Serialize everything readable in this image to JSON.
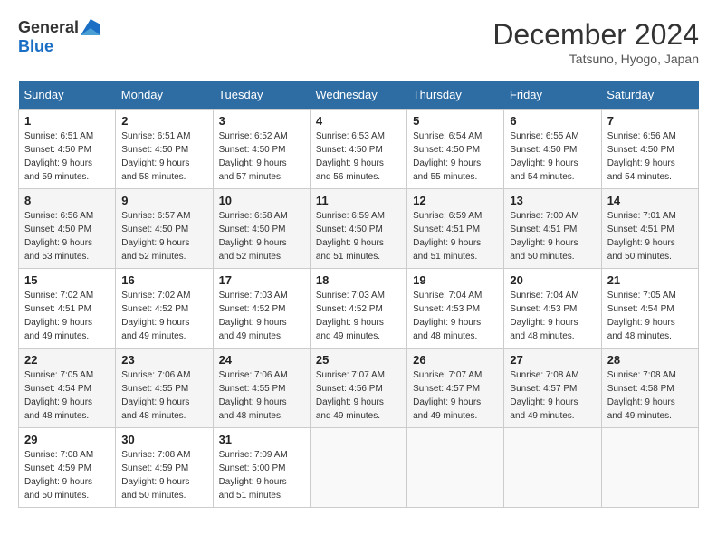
{
  "header": {
    "logo_general": "General",
    "logo_blue": "Blue",
    "title": "December 2024",
    "location": "Tatsuno, Hyogo, Japan"
  },
  "calendar": {
    "days_of_week": [
      "Sunday",
      "Monday",
      "Tuesday",
      "Wednesday",
      "Thursday",
      "Friday",
      "Saturday"
    ],
    "weeks": [
      [
        {
          "day": "1",
          "sunrise": "6:51 AM",
          "sunset": "4:50 PM",
          "daylight": "9 hours and 59 minutes."
        },
        {
          "day": "2",
          "sunrise": "6:51 AM",
          "sunset": "4:50 PM",
          "daylight": "9 hours and 58 minutes."
        },
        {
          "day": "3",
          "sunrise": "6:52 AM",
          "sunset": "4:50 PM",
          "daylight": "9 hours and 57 minutes."
        },
        {
          "day": "4",
          "sunrise": "6:53 AM",
          "sunset": "4:50 PM",
          "daylight": "9 hours and 56 minutes."
        },
        {
          "day": "5",
          "sunrise": "6:54 AM",
          "sunset": "4:50 PM",
          "daylight": "9 hours and 55 minutes."
        },
        {
          "day": "6",
          "sunrise": "6:55 AM",
          "sunset": "4:50 PM",
          "daylight": "9 hours and 54 minutes."
        },
        {
          "day": "7",
          "sunrise": "6:56 AM",
          "sunset": "4:50 PM",
          "daylight": "9 hours and 54 minutes."
        }
      ],
      [
        {
          "day": "8",
          "sunrise": "6:56 AM",
          "sunset": "4:50 PM",
          "daylight": "9 hours and 53 minutes."
        },
        {
          "day": "9",
          "sunrise": "6:57 AM",
          "sunset": "4:50 PM",
          "daylight": "9 hours and 52 minutes."
        },
        {
          "day": "10",
          "sunrise": "6:58 AM",
          "sunset": "4:50 PM",
          "daylight": "9 hours and 52 minutes."
        },
        {
          "day": "11",
          "sunrise": "6:59 AM",
          "sunset": "4:50 PM",
          "daylight": "9 hours and 51 minutes."
        },
        {
          "day": "12",
          "sunrise": "6:59 AM",
          "sunset": "4:51 PM",
          "daylight": "9 hours and 51 minutes."
        },
        {
          "day": "13",
          "sunrise": "7:00 AM",
          "sunset": "4:51 PM",
          "daylight": "9 hours and 50 minutes."
        },
        {
          "day": "14",
          "sunrise": "7:01 AM",
          "sunset": "4:51 PM",
          "daylight": "9 hours and 50 minutes."
        }
      ],
      [
        {
          "day": "15",
          "sunrise": "7:02 AM",
          "sunset": "4:51 PM",
          "daylight": "9 hours and 49 minutes."
        },
        {
          "day": "16",
          "sunrise": "7:02 AM",
          "sunset": "4:52 PM",
          "daylight": "9 hours and 49 minutes."
        },
        {
          "day": "17",
          "sunrise": "7:03 AM",
          "sunset": "4:52 PM",
          "daylight": "9 hours and 49 minutes."
        },
        {
          "day": "18",
          "sunrise": "7:03 AM",
          "sunset": "4:52 PM",
          "daylight": "9 hours and 49 minutes."
        },
        {
          "day": "19",
          "sunrise": "7:04 AM",
          "sunset": "4:53 PM",
          "daylight": "9 hours and 48 minutes."
        },
        {
          "day": "20",
          "sunrise": "7:04 AM",
          "sunset": "4:53 PM",
          "daylight": "9 hours and 48 minutes."
        },
        {
          "day": "21",
          "sunrise": "7:05 AM",
          "sunset": "4:54 PM",
          "daylight": "9 hours and 48 minutes."
        }
      ],
      [
        {
          "day": "22",
          "sunrise": "7:05 AM",
          "sunset": "4:54 PM",
          "daylight": "9 hours and 48 minutes."
        },
        {
          "day": "23",
          "sunrise": "7:06 AM",
          "sunset": "4:55 PM",
          "daylight": "9 hours and 48 minutes."
        },
        {
          "day": "24",
          "sunrise": "7:06 AM",
          "sunset": "4:55 PM",
          "daylight": "9 hours and 48 minutes."
        },
        {
          "day": "25",
          "sunrise": "7:07 AM",
          "sunset": "4:56 PM",
          "daylight": "9 hours and 49 minutes."
        },
        {
          "day": "26",
          "sunrise": "7:07 AM",
          "sunset": "4:57 PM",
          "daylight": "9 hours and 49 minutes."
        },
        {
          "day": "27",
          "sunrise": "7:08 AM",
          "sunset": "4:57 PM",
          "daylight": "9 hours and 49 minutes."
        },
        {
          "day": "28",
          "sunrise": "7:08 AM",
          "sunset": "4:58 PM",
          "daylight": "9 hours and 49 minutes."
        }
      ],
      [
        {
          "day": "29",
          "sunrise": "7:08 AM",
          "sunset": "4:59 PM",
          "daylight": "9 hours and 50 minutes."
        },
        {
          "day": "30",
          "sunrise": "7:08 AM",
          "sunset": "4:59 PM",
          "daylight": "9 hours and 50 minutes."
        },
        {
          "day": "31",
          "sunrise": "7:09 AM",
          "sunset": "5:00 PM",
          "daylight": "9 hours and 51 minutes."
        },
        null,
        null,
        null,
        null
      ]
    ]
  }
}
